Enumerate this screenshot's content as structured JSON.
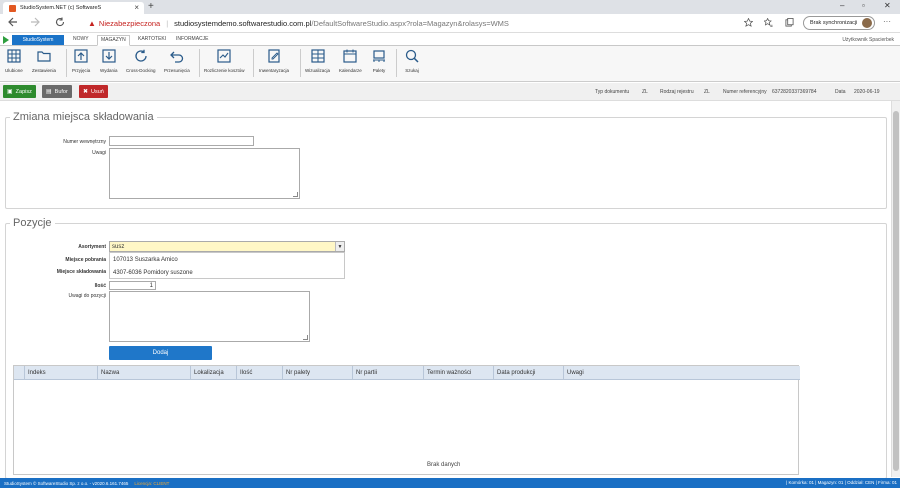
{
  "browser": {
    "tab_title": "StudioSystem.NET (c) SoftwareS",
    "tab_close": "×",
    "new_tab": "+",
    "win_min": "–",
    "win_max": "▫",
    "win_close": "✕",
    "warn_glyph": "▲",
    "security_label": "Niezabezpieczona",
    "url_sep": "|",
    "url_host": "studiosystemdemo.softwarestudio.com.pl",
    "url_path": "/DefaultSoftwareStudio.aspx?rola=Magazyn&rolasys=WMS",
    "sync_label": "Brak synchronizacji",
    "more": "···"
  },
  "ribbon_tabs": {
    "system": "StudioSystem",
    "tabs": [
      "NOWY",
      "MAGAZYN",
      "KARTOTEKI",
      "INFORMACJE"
    ],
    "user": "Użytkownik Spacierbek"
  },
  "ribbon": {
    "buttons": [
      "Ulubione",
      "Zestawienia",
      "Przyjęcia",
      "Wydania",
      "Cross-Docking",
      "Przesunięcia",
      "Rozliczenie kosztów",
      "Inwentaryzacja",
      "Wizualizacja",
      "Kalendarze",
      "Palety",
      "Szukaj"
    ]
  },
  "actions": {
    "save": "Zapisz",
    "buffer": "Bufor",
    "delete": "Usuń",
    "colors": {
      "save": "#2e8b2e",
      "buffer": "#6a6a6a",
      "delete": "#c0282a"
    }
  },
  "doc_meta": {
    "type_label": "Typ dokumentu",
    "type_value": "ZL",
    "reg_label": "Rodzaj rejestru",
    "reg_value": "ZL",
    "ref_label": "Numer referencyjny",
    "ref_value": "6372820337369784",
    "date_label": "Data",
    "date_value": "2020-06-19"
  },
  "section1": {
    "legend": "Zmiana miejsca składowania",
    "internal_no_label": "Numer wewnętrzny",
    "internal_no_value": "",
    "notes_label": "Uwagi"
  },
  "section2": {
    "legend": "Pozycje",
    "assortment_label": "Asortyment",
    "assortment_value": "susz",
    "dropdown_arrow": "▼",
    "options": [
      "107013 Suszarka Amico",
      "4307-6036 Pomidory suszone"
    ],
    "pickup_label": "Miejsce pobrania",
    "storage_label": "Miejsce składowania",
    "qty_label": "Ilość",
    "qty_value": "1",
    "pos_notes_label": "Uwagi do pozycji",
    "add_button": "Dodaj"
  },
  "grid": {
    "columns": [
      "Indeks",
      "Nazwa",
      "Lokalizacja",
      "Ilość",
      "Nr palety",
      "Nr partii",
      "Termin ważności",
      "Data produkcji",
      "Uwagi"
    ],
    "empty": "Brak danych"
  },
  "status": {
    "left": "StudioSystem © SoftwareStudio Sp. z o.o. - v2020.6.161.7465",
    "license": "Licencja: CLIENT",
    "right": "| Komórka: 01 | Magazyn: 01 | Oddział: CEN | Firma: 01"
  }
}
